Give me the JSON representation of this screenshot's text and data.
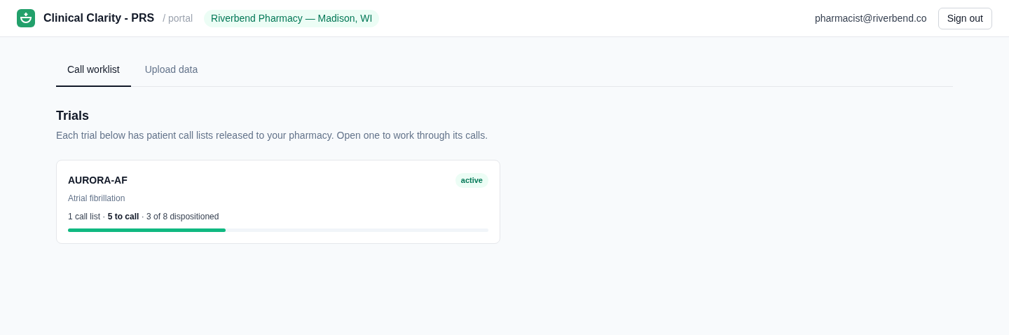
{
  "header": {
    "app_name": "Clinical Clarity - PRS",
    "section": "/ portal",
    "pharmacy": "Riverbend Pharmacy — Madison, WI",
    "user_email": "pharmacist@riverbend.co",
    "sign_out": "Sign out"
  },
  "tabs": [
    {
      "label": "Call worklist",
      "selected": true
    },
    {
      "label": "Upload data",
      "selected": false
    }
  ],
  "heading": "Trials",
  "description": "Each trial below has patient call lists released to your pharmacy. Open one to work through its calls.",
  "trials": [
    {
      "name": "AURORA-AF",
      "status": "active",
      "condition": "Atrial fibrillation",
      "summary": "1 call list · **5 to call** · 3 of 8 dispositioned",
      "level": 0.375
    }
  ]
}
